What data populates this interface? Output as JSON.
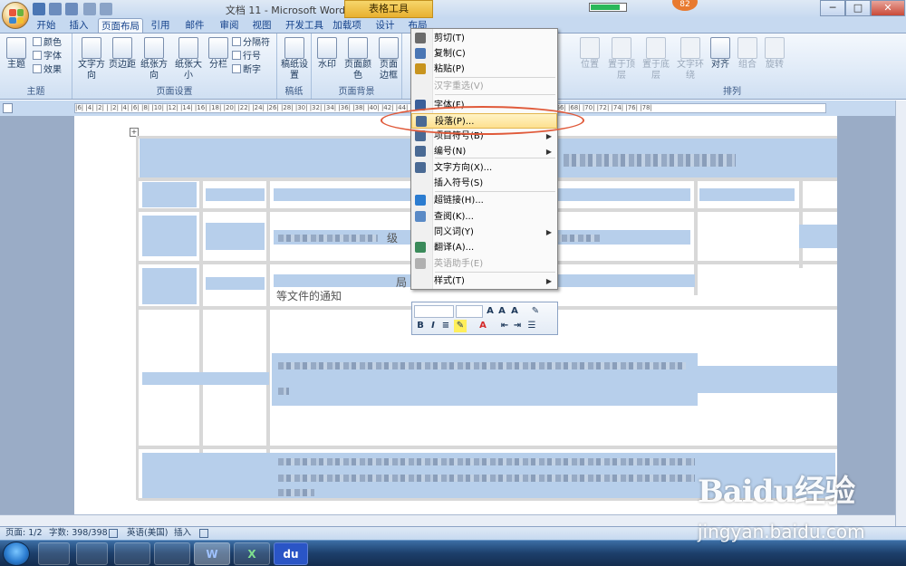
{
  "window": {
    "title": "文档 11 - Microsoft Word",
    "context_tab": "表格工具",
    "controls": [
      "─",
      "□",
      "✕"
    ],
    "notification_count": "82"
  },
  "tabs": [
    "开始",
    "插入",
    "页面布局",
    "引用",
    "邮件",
    "审阅",
    "视图",
    "开发工具",
    "加载项",
    "设计",
    "布局"
  ],
  "active_tab": "页面布局",
  "ribbon": {
    "theme_group": {
      "label": "主题",
      "big": "主题",
      "small": [
        "颜色",
        "字体",
        "效果"
      ]
    },
    "page_setup_group": {
      "label": "页面设置",
      "buttons": [
        "文字方向",
        "页边距",
        "纸张方向",
        "纸张大小",
        "分栏"
      ],
      "small": [
        "分隔符",
        "行号",
        "断字"
      ]
    },
    "paper_group": {
      "label": "稿纸",
      "buttons": [
        "稿纸设置"
      ]
    },
    "page_bg_group": {
      "label": "页面背景",
      "buttons": [
        "水印",
        "页面颜色",
        "页面边框"
      ]
    },
    "arrange_group": {
      "label": "排列",
      "buttons": [
        "位置",
        "置于顶层",
        "置于底层",
        "文字环绕",
        "对齐",
        "组合",
        "旋转"
      ]
    }
  },
  "ruler": {
    "marks": "|6| |4| |2| |  |2| |4| |6| |8| |10| |12| |14| |16| |18| |20| |22| |24| |26| |28| |30| |32| |34| |36| |38| |40| |42| |44| |46| |48| |50| |52| |54| |56| |58| |60| |62| |64| |66| |68| |70| |72| |74| |76| |78|"
  },
  "document": {
    "partial_text_1": "级",
    "partial_text_2": "局",
    "partial_text_3": "等文件的通知"
  },
  "context_menu": {
    "items": [
      {
        "label": "剪切(T)",
        "icon": "scissors-icon",
        "disabled": false
      },
      {
        "label": "复制(C)",
        "icon": "copy-icon",
        "disabled": false
      },
      {
        "label": "粘贴(P)",
        "icon": "paste-icon",
        "disabled": false
      },
      {
        "label": "汉字重选(V)",
        "icon": "",
        "disabled": true
      },
      {
        "label": "字体(F)...",
        "icon": "font-icon",
        "disabled": false
      },
      {
        "label": "段落(P)...",
        "icon": "paragraph-icon",
        "disabled": false,
        "highlighted": true
      },
      {
        "label": "项目符号(B)",
        "icon": "bullets-icon",
        "disabled": false,
        "submenu": true
      },
      {
        "label": "编号(N)",
        "icon": "numbering-icon",
        "disabled": false,
        "submenu": true
      },
      {
        "label": "文字方向(X)...",
        "icon": "text-direction-icon",
        "disabled": false
      },
      {
        "label": "插入符号(S)",
        "icon": "",
        "disabled": false
      },
      {
        "label": "超链接(H)...",
        "icon": "hyperlink-icon",
        "disabled": false
      },
      {
        "label": "查阅(K)...",
        "icon": "lookup-icon",
        "disabled": false
      },
      {
        "label": "同义词(Y)",
        "icon": "",
        "disabled": false,
        "submenu": true
      },
      {
        "label": "翻译(A)...",
        "icon": "translate-icon",
        "disabled": false
      },
      {
        "label": "英语助手(E)",
        "icon": "assistant-icon",
        "disabled": true
      },
      {
        "label": "样式(T)",
        "icon": "",
        "disabled": false,
        "submenu": true
      }
    ]
  },
  "status_bar": {
    "page": "页面: 1/2",
    "words": "字数: 398/398",
    "language": "英语(美国)",
    "mode": "插入"
  },
  "taskbar": {
    "apps": [
      "W",
      "X",
      "du"
    ]
  },
  "watermark": {
    "logo": "Baidu经验",
    "url": "jingyan.baidu.com"
  },
  "colors": {
    "ribbon_bg": "#dfeaf7",
    "highlight_oval": "#e05a3a",
    "menu_hover": "#fde08e",
    "selection": "#b7cfeb"
  }
}
